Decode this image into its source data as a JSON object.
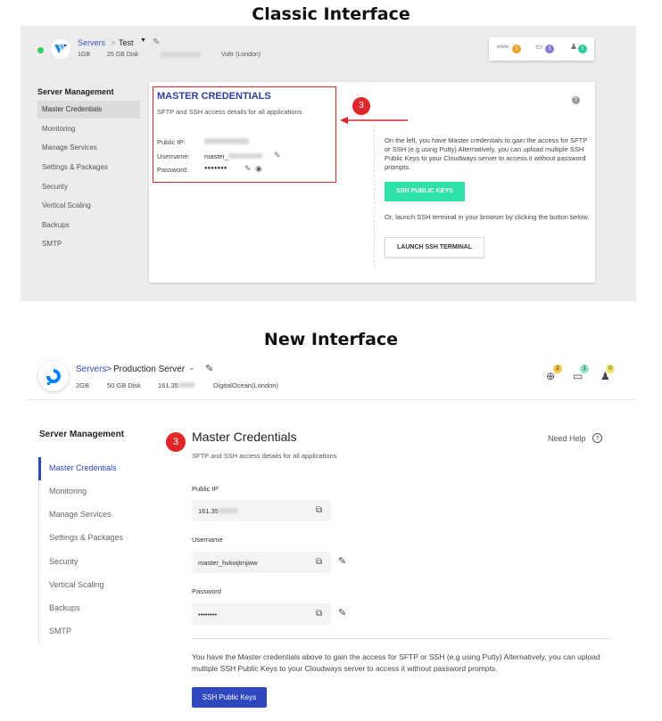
{
  "classic": {
    "section_title": "Classic Interface",
    "header": {
      "breadcrumb_servers": "Servers",
      "breadcrumb_sep": ">",
      "server_name": "Test",
      "ram": "1GB",
      "disk": "25 GB Disk",
      "provider": "Vultr (London)"
    },
    "top_icons": {
      "apps_label": "www",
      "apps_count": "1",
      "notifications_count": "1",
      "users_count": "1"
    },
    "sidebar": {
      "title": "Server Management",
      "items": [
        "Master Credentials",
        "Monitoring",
        "Manage Services",
        "Settings & Packages",
        "Security",
        "Vertical Scaling",
        "Backups",
        "SMTP"
      ]
    },
    "panel": {
      "title": "MASTER CREDENTIALS",
      "subtitle": "SFTP and SSH access details for all applications",
      "public_ip_label": "Public IP:",
      "username_label": "Username:",
      "username_value": "master_",
      "password_label": "Password:",
      "password_value": "●●●●●●●",
      "step_number": "3",
      "help": "?",
      "description": "On the left, you have Master credentials to gain the access for SFTP or SSH (e.g using Putty) Alternatively, you can upload multiple SSH Public Keys to your Cloudways server to access it without password prompts.",
      "ssh_button": "SSH PUBLIC KEYS",
      "terminal_description": "Or, launch SSH terminal in your browser by clicking the button below.",
      "terminal_button": "LAUNCH SSH TERMINAL"
    }
  },
  "new": {
    "section_title": "New Interface",
    "header": {
      "breadcrumb_servers": "Servers",
      "breadcrumb_sep": ">",
      "server_name": "Production Server",
      "ram": "2GB",
      "disk": "50 GB Disk",
      "ip": "161.35",
      "provider": "DigitalOcean(London)"
    },
    "top_icons": {
      "apps_count": "2",
      "files_count": "1",
      "users_count": "0"
    },
    "sidebar": {
      "title": "Server Management",
      "items": [
        "Master Credentials",
        "Monitoring",
        "Manage Services",
        "Settings & Packages",
        "Security",
        "Vertical Scaling",
        "Backups",
        "SMTP"
      ]
    },
    "panel": {
      "step_number": "3",
      "title": "Master Credentials",
      "need_help": "Need Help",
      "help_icon": "?",
      "subtitle": "SFTP and SSH access details for all applications",
      "public_ip_label": "Public IP",
      "public_ip_value": "161.35",
      "username_label": "Username",
      "username_value": "master_hvkwjtmjww",
      "password_label": "Password",
      "password_value": "••••••••",
      "description": "You have the Master credentials above to gain the access for SFTP or SSH (e.g using Putty) Alternatively, you can upload multiple SSH Public Keys to your Cloudways server to access it without password prompts.",
      "ssh_button": "SSH Public Keys"
    }
  },
  "colors": {
    "accent_blue": "#2f48bf",
    "badge_red": "#e0262b",
    "ssh_green": "#2fe0a8"
  }
}
